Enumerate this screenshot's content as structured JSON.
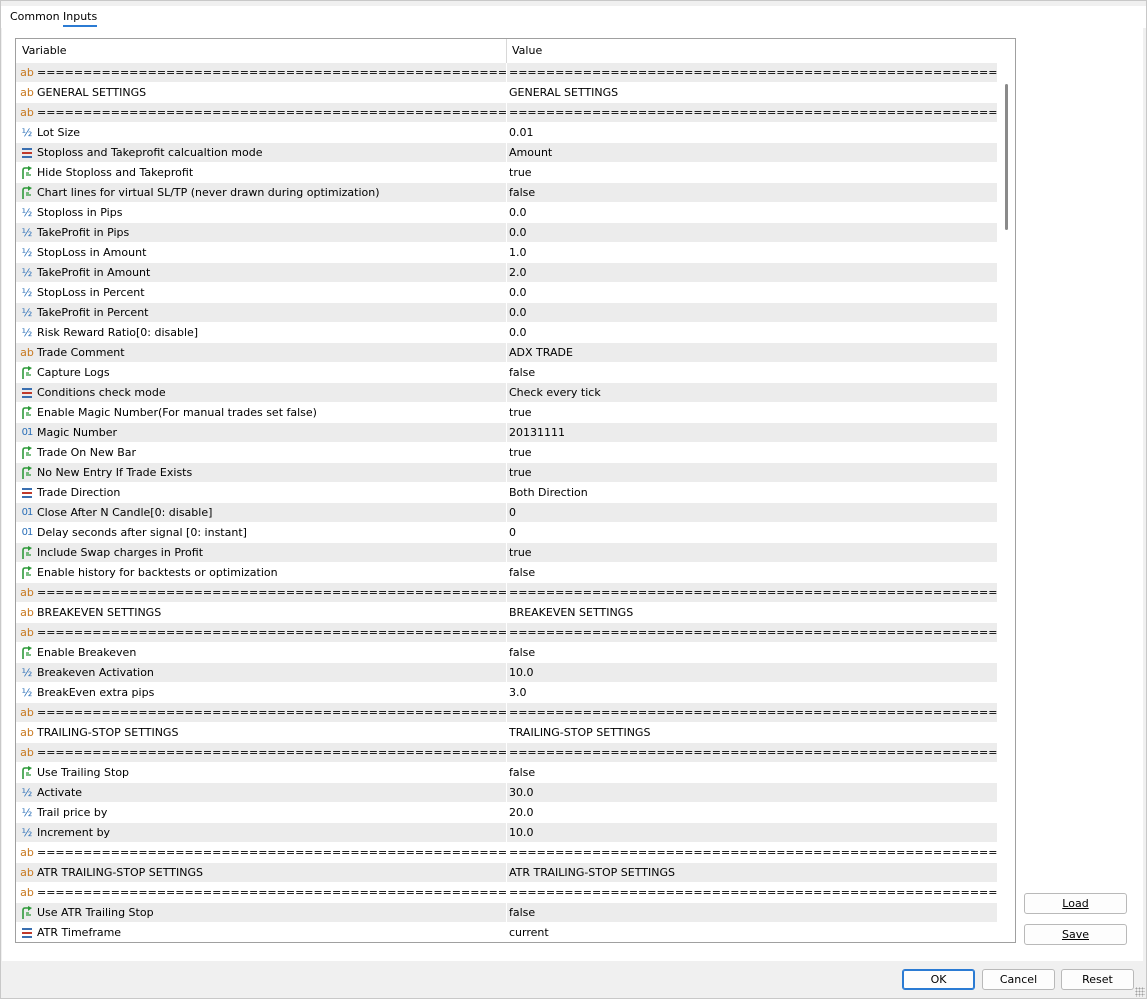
{
  "tabs": [
    {
      "label": "Common"
    },
    {
      "label": "Inputs"
    }
  ],
  "grid": {
    "columns": {
      "variable": "Variable",
      "value": "Value"
    },
    "rows": [
      {
        "icon": "ab",
        "variable": "=====================================================...",
        "value": "============================================================"
      },
      {
        "icon": "ab",
        "variable": "GENERAL SETTINGS",
        "value": "GENERAL SETTINGS"
      },
      {
        "icon": "ab",
        "variable": "=====================================================...",
        "value": "============================================================"
      },
      {
        "icon": "frac",
        "variable": "Lot Size",
        "value": "0.01"
      },
      {
        "icon": "enum",
        "variable": "Stoploss and Takeprofit calcualtion mode",
        "value": "Amount"
      },
      {
        "icon": "bool",
        "variable": "Hide Stoploss and Takeprofit",
        "value": "true"
      },
      {
        "icon": "bool",
        "variable": "Chart lines for virtual SL/TP (never drawn during optimization)",
        "value": "false"
      },
      {
        "icon": "frac",
        "variable": "Stoploss in Pips",
        "value": "0.0"
      },
      {
        "icon": "frac",
        "variable": "TakeProfit in Pips",
        "value": "0.0"
      },
      {
        "icon": "frac",
        "variable": "StopLoss in Amount",
        "value": "1.0"
      },
      {
        "icon": "frac",
        "variable": "TakeProfit in Amount",
        "value": "2.0"
      },
      {
        "icon": "frac",
        "variable": "StopLoss in Percent",
        "value": "0.0"
      },
      {
        "icon": "frac",
        "variable": "TakeProfit in Percent",
        "value": "0.0"
      },
      {
        "icon": "frac",
        "variable": "Risk Reward Ratio[0: disable]",
        "value": "0.0"
      },
      {
        "icon": "ab",
        "variable": "Trade Comment",
        "value": "ADX TRADE"
      },
      {
        "icon": "bool",
        "variable": "Capture Logs",
        "value": "false"
      },
      {
        "icon": "enum",
        "variable": "Conditions check mode",
        "value": "Check every tick"
      },
      {
        "icon": "bool",
        "variable": "Enable Magic Number(For manual trades set false)",
        "value": "true"
      },
      {
        "icon": "num",
        "variable": "Magic Number",
        "value": "20131111"
      },
      {
        "icon": "bool",
        "variable": "Trade On New Bar",
        "value": "true"
      },
      {
        "icon": "bool",
        "variable": "No New Entry If Trade Exists",
        "value": "true"
      },
      {
        "icon": "enum",
        "variable": "Trade Direction",
        "value": "Both Direction"
      },
      {
        "icon": "num",
        "variable": "Close After N Candle[0: disable]",
        "value": "0"
      },
      {
        "icon": "num",
        "variable": "Delay seconds after signal [0: instant]",
        "value": "0"
      },
      {
        "icon": "bool",
        "variable": "Include Swap charges in Profit",
        "value": "true"
      },
      {
        "icon": "bool",
        "variable": "Enable history for backtests or optimization",
        "value": "false"
      },
      {
        "icon": "ab",
        "variable": "=====================================================...",
        "value": "============================================================"
      },
      {
        "icon": "ab",
        "variable": "BREAKEVEN SETTINGS",
        "value": "BREAKEVEN SETTINGS"
      },
      {
        "icon": "ab",
        "variable": "=====================================================...",
        "value": "============================================================"
      },
      {
        "icon": "bool",
        "variable": "Enable Breakeven",
        "value": "false"
      },
      {
        "icon": "frac",
        "variable": "Breakeven Activation",
        "value": "10.0"
      },
      {
        "icon": "frac",
        "variable": "BreakEven extra pips",
        "value": "3.0"
      },
      {
        "icon": "ab",
        "variable": "=====================================================...",
        "value": "============================================================"
      },
      {
        "icon": "ab",
        "variable": "TRAILING-STOP SETTINGS",
        "value": "TRAILING-STOP SETTINGS"
      },
      {
        "icon": "ab",
        "variable": "=====================================================...",
        "value": "============================================================"
      },
      {
        "icon": "bool",
        "variable": "Use Trailing Stop",
        "value": "false"
      },
      {
        "icon": "frac",
        "variable": "Activate",
        "value": "30.0"
      },
      {
        "icon": "frac",
        "variable": "Trail price by",
        "value": "20.0"
      },
      {
        "icon": "frac",
        "variable": "Increment by",
        "value": "10.0"
      },
      {
        "icon": "ab",
        "variable": "=====================================================...",
        "value": "============================================================"
      },
      {
        "icon": "ab",
        "variable": "ATR TRAILING-STOP SETTINGS",
        "value": "ATR TRAILING-STOP SETTINGS"
      },
      {
        "icon": "ab",
        "variable": "=====================================================...",
        "value": "============================================================"
      },
      {
        "icon": "bool",
        "variable": "Use ATR Trailing Stop",
        "value": "false"
      },
      {
        "icon": "enum",
        "variable": "ATR Timeframe",
        "value": "current"
      }
    ]
  },
  "buttons": {
    "load": "Load",
    "save": "Save",
    "ok": "OK",
    "cancel": "Cancel",
    "reset": "Reset"
  },
  "icon_glyphs": {
    "ab": "ab",
    "num": "01",
    "frac": "½"
  },
  "colors": {
    "accent": "#2b7bd3",
    "row_alt": "#ececec",
    "icon_ab": "#c8781e",
    "icon_blue": "#2a6fb8",
    "icon_bool": "#2e9a3a"
  }
}
